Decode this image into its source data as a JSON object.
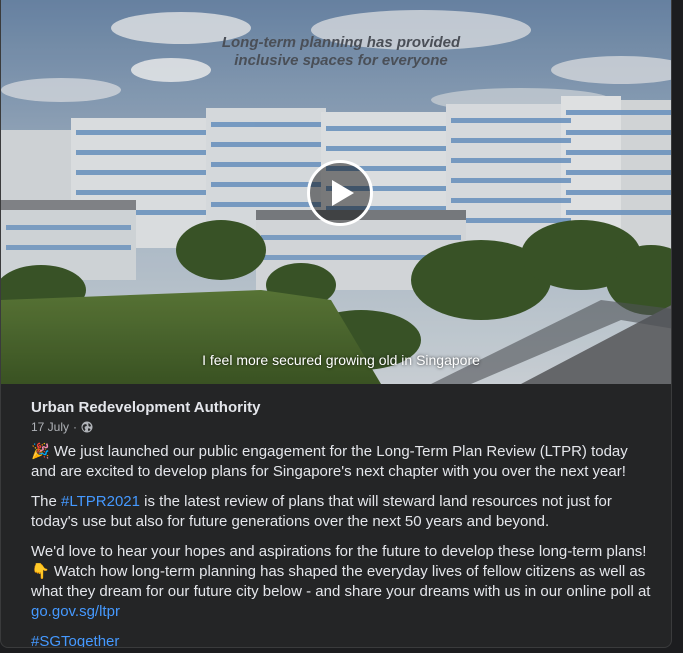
{
  "video": {
    "overlay_title_line1": "Long-term planning has provided",
    "overlay_title_line2": "inclusive spaces for everyone",
    "caption": "I feel more secured growing old in Singapore",
    "play_icon": "play-icon"
  },
  "post": {
    "author": "Urban Redevelopment Authority",
    "date": "17 July",
    "separator": "·",
    "audience_icon": "globe-icon",
    "para1": {
      "emoji": "🎉",
      "text": "We just launched our public engagement for the Long-Term Plan Review (LTPR) today and are excited to develop plans for Singapore's next chapter with you over the next year!"
    },
    "para2": {
      "prefix": "The",
      "hashtag": "#LTPR2021",
      "text": "is the latest review of plans that will steward land resources not just for today's use but also for future generations over the next 50 years and beyond."
    },
    "para3": {
      "text_before": "We'd love to hear your hopes and aspirations for the future to develop these long-term plans!",
      "emoji": "👇",
      "text_after": "Watch how long-term planning has shaped the everyday lives of fellow citizens as well as what they dream for our future city below - and share your dreams with us in our online poll at",
      "link": "go.gov.sg/ltpr"
    },
    "hashtag_footer": "#SGTogether"
  },
  "colors": {
    "background": "#242526",
    "text": "#e4e6eb",
    "secondary_text": "#b0b3b8",
    "link": "#4599ff"
  }
}
